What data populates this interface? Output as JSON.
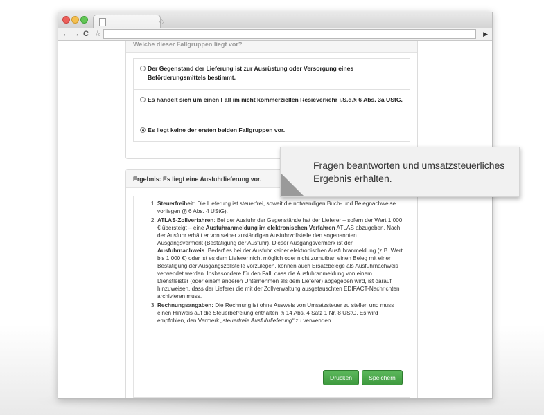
{
  "panel1": {
    "heading": "Welche dieser Fallgruppen liegt vor?",
    "options": [
      {
        "text": "Der Gegenstand der Lieferung ist zur Ausrüstung oder Versorgung eines Beförderungsmittels bestimmt.",
        "selected": false
      },
      {
        "text": "Es handelt sich um einen Fall im nicht kommerziellen Resieverkehr i.S.d.§ 6 Abs. 3a UStG.",
        "selected": false
      },
      {
        "text": "Es liegt keine der ersten beiden Fallgruppen vor.",
        "selected": true
      }
    ]
  },
  "result": {
    "heading": "Ergebnis: Es liegt eine Ausfuhrlieferung vor.",
    "items": [
      {
        "title": "Steuerfreiheit",
        "p1": ": Die Lieferung ist steuerfrei, soweit die notwendigen Buch- und Belegnachweise vorliegen (§ 6 Abs. 4 UStG)."
      },
      {
        "title": "ATLAS-Zollverfahren",
        "p1": ": Bei der Ausfuhr der Gegenstände hat der Lieferer – sofern der Wert 1.000 € übersteigt – eine ",
        "bold1": "Ausfuhranmeldung im elektronischen Verfahren",
        "p2": " ATLAS abzugeben. Nach der Ausfuhr erhält er von seiner zuständigen Ausfuhrzollstelle den sogenannten Ausgangsvermerk (Bestätigung der Ausfuhr). Dieser Ausgangsvermerk ist der ",
        "bold2": "Ausfuhrnachweis",
        "p3": ". Bedarf es bei der Ausfuhr keiner elektronischen Ausfuhranmeldung (z.B. Wert bis 1.000 €) oder ist es dem Lieferer nicht möglich oder nicht zumutbar, einen Beleg mit einer Bestätigung der Ausgangszollstelle vorzulegen, können auch Ersatzbelege als Ausfuhrnachweis verwendet werden. Insbesondere für den Fall, dass die Ausfuhranmeldung von einem Dienstleister (oder einem anderen Unternehmen als dem Lieferer) abgegeben wird, ist darauf hinzuweisen, dass der Lieferer die mit der Zollverwaltung ausgetauschten EDIFACT-Nachrichten archivieren muss."
      },
      {
        "title": "Rechnungsangaben:",
        "p1": " Die Rechnung ist ohne Ausweis von Umsatzsteuer zu stellen und muss einen Hinweis auf die Steuerbefreiung enthalten, § 14 Abs. 4 Satz 1 Nr. 8 UStG. Es wird empfohlen, den Vermerk ",
        "italic1": "„steuerfreie Ausfuhrlieferung“",
        "p2": " zu verwenden."
      }
    ]
  },
  "buttons": {
    "print": "Drucken",
    "save": "Speichern"
  },
  "callout": {
    "text": "Fragen beantworten und umsatzsteuerliches Ergebnis erhalten."
  },
  "colors": {
    "button_green": "#4cae4c"
  }
}
